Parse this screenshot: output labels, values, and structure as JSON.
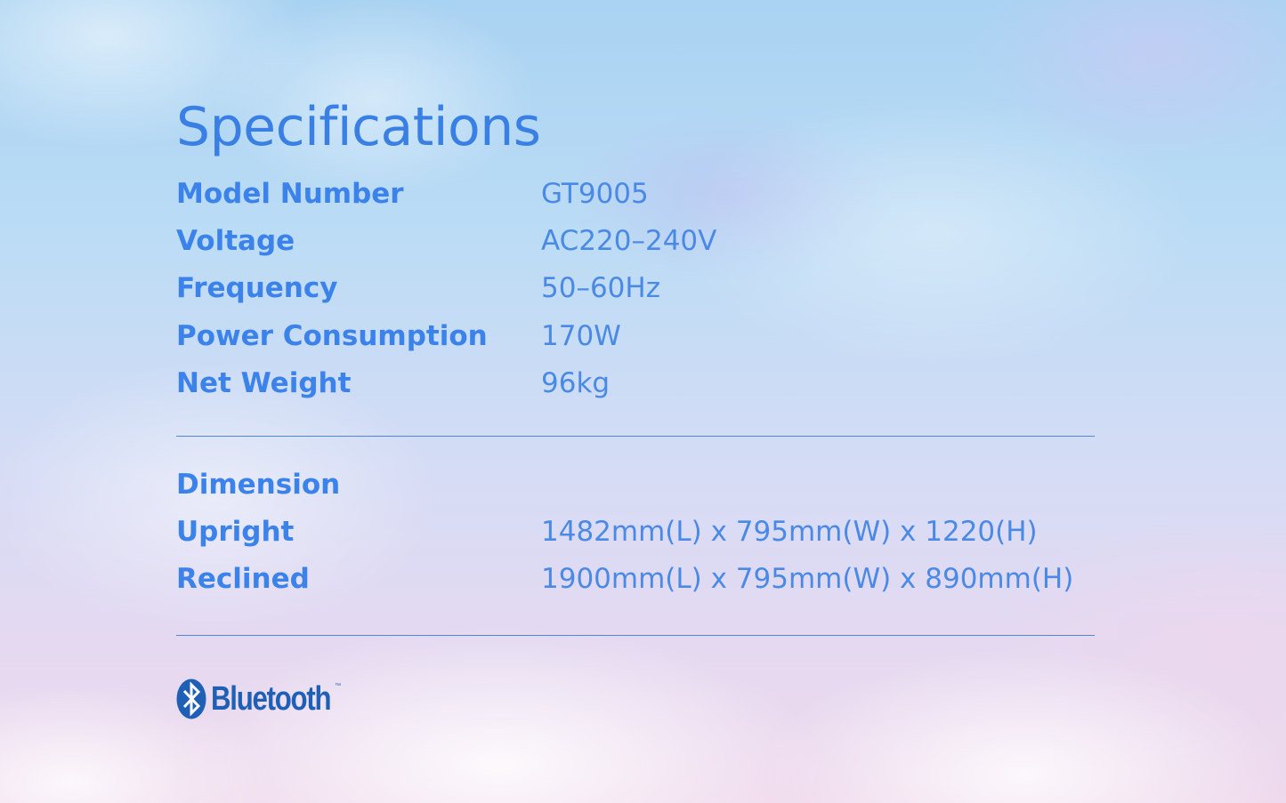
{
  "title": "Specifications",
  "specs": [
    {
      "label": "Model Number",
      "value": "GT9005"
    },
    {
      "label": "Voltage",
      "value": "AC220–240V"
    },
    {
      "label": "Frequency",
      "value": "50–60Hz"
    },
    {
      "label": "Power Consumption",
      "value": "170W"
    },
    {
      "label": "Net Weight",
      "value": "96kg"
    }
  ],
  "dimension": {
    "heading": "Dimension",
    "rows": [
      {
        "label": "Upright",
        "value": "1482mm(L) x 795mm(W) x 1220(H)"
      },
      {
        "label": "Reclined",
        "value": "1900mm(L) x 795mm(W) x 890mm(H)"
      }
    ]
  },
  "bluetooth": {
    "icon": "bluetooth-icon",
    "wordmark": "Bluetooth",
    "trademark": "™"
  },
  "colors": {
    "heading_blue": "#3a80e4",
    "label_blue": "#3b82ea",
    "value_blue": "#4a8ae6",
    "divider_blue": "#4f86d6",
    "bluetooth_blue": "#1f5fb6"
  }
}
